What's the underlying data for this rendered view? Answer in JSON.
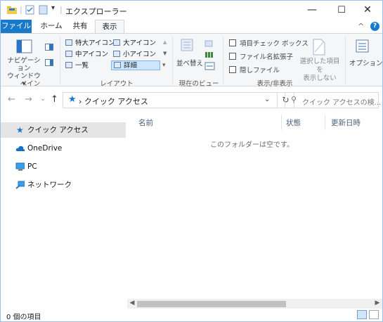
{
  "window": {
    "title": "エクスプローラー",
    "controls": {
      "minimize": "—",
      "maximize": "☐",
      "close": "✕"
    }
  },
  "ribbon_tabs": [
    "ファイル",
    "ホーム",
    "共有",
    "表示"
  ],
  "ribbon_right": {
    "collapse": "^",
    "help": "?"
  },
  "ribbon": {
    "pane": {
      "nav_pane_label": "ナビゲーション\nウィンドウ ▾",
      "group_label": "ペイン"
    },
    "layout": {
      "items": [
        "特大アイコン",
        "大アイコン",
        "中アイコン",
        "小アイコン",
        "一覧",
        "詳細"
      ],
      "selected": "詳細",
      "group_label": "レイアウト"
    },
    "current_view": {
      "sort_label": "並べ替え",
      "group_label": "現在のビュー"
    },
    "show_hide": {
      "checkboxes": [
        "項目チェック ボックス",
        "ファイル名拡張子",
        "隠しファイル"
      ],
      "hide_selected": "選択した項目を\n表示しない",
      "group_label": "表示/非表示"
    },
    "options_label": "オプション"
  },
  "navigation": {
    "back": "←",
    "forward": "→",
    "recent": "⌄",
    "up": "↑",
    "address_path": "› クイック アクセス",
    "dropdown": "⌄",
    "refresh": "↻",
    "search_placeholder": "クイック アクセスの検..."
  },
  "nav_pane": {
    "items": [
      "クイック アクセス",
      "OneDrive",
      "PC",
      "ネットワーク"
    ],
    "selected": "クイック アクセス"
  },
  "content": {
    "columns": [
      "名前",
      "状態",
      "更新日時"
    ],
    "empty_message": "このフォルダーは空です。"
  },
  "status": {
    "item_count": "0 個の項目"
  },
  "colors": {
    "accent": "#1979ca",
    "selection": "#e5e5e5",
    "ribbon_bg": "#f5f6f7"
  }
}
